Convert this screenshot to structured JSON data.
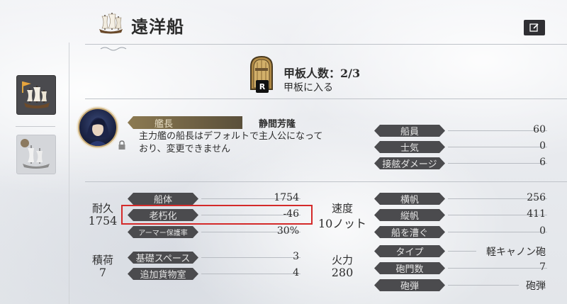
{
  "header": {
    "title": "遠洋船",
    "edit_icon": "edit-icon"
  },
  "deck": {
    "crew_text": "甲板人数：2/3",
    "enter_text": "甲板に入る",
    "key_label": "R"
  },
  "captain": {
    "label": "艦長",
    "name": "静間芳隆",
    "description_line1": "主力艦の船長はデフォルトで主人公になって",
    "description_line2": "おり、変更できません"
  },
  "crew_stats": [
    {
      "label": "船員",
      "value": "60"
    },
    {
      "label": "士気",
      "value": "0"
    },
    {
      "label": "接舷ダメージ",
      "value": "6"
    }
  ],
  "durability": {
    "label": "耐久",
    "value": "1754",
    "rows": [
      {
        "label": "船体",
        "value": "1754"
      },
      {
        "label": "老朽化",
        "value": "-46"
      },
      {
        "label": "アーマー保護率",
        "value": "30%"
      }
    ]
  },
  "speed": {
    "label": "速度",
    "value": "10ノット",
    "rows": [
      {
        "label": "横帆",
        "value": "256"
      },
      {
        "label": "縦帆",
        "value": "411"
      },
      {
        "label": "船を漕ぐ",
        "value": "0"
      }
    ]
  },
  "cargo": {
    "label": "積荷",
    "value": "7",
    "rows": [
      {
        "label": "基礎スペース",
        "value": "3"
      },
      {
        "label": "追加貨物室",
        "value": "4"
      }
    ]
  },
  "firepower": {
    "label": "火力",
    "value": "280",
    "rows": [
      {
        "label": "タイプ",
        "value": "軽キャノン砲"
      },
      {
        "label": "砲門数",
        "value": "7"
      },
      {
        "label": "砲弾",
        "value": "砲弾"
      }
    ]
  },
  "colors": {
    "label_bg": "#4b4b4e",
    "highlight": "#d42a2a",
    "gold": "#c7a971"
  }
}
